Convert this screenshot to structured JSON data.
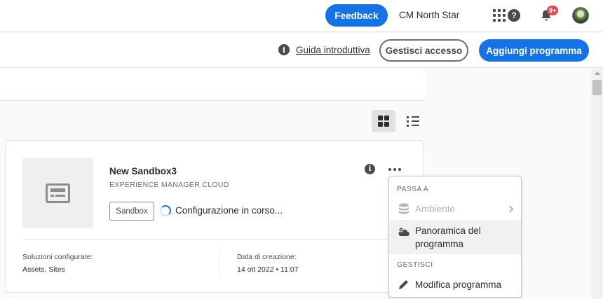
{
  "header": {
    "feedback_label": "Feedback",
    "org_name": "CM North Star",
    "apps_icon": "apps-grid-icon",
    "help_icon": "help-icon",
    "notifications_badge": "9+",
    "avatar_icon": "avatar"
  },
  "actions": {
    "guide_label": "Guida introduttiva",
    "manage_access_label": "Gestisci accesso",
    "add_program_label": "Aggiungi programma"
  },
  "view_toggle": {
    "grid_icon": "grid-view-icon",
    "list_icon": "list-view-icon",
    "selected": "grid"
  },
  "program_card": {
    "name": "New Sandbox3",
    "type": "EXPERIENCE MANAGER CLOUD",
    "badge": "Sandbox",
    "status": "Configurazione in corso...",
    "solutions_label": "Soluzioni configurate:",
    "solutions_value": "Assets, Sites",
    "created_label": "Data di creazione:",
    "created_value": "14 ott 2022 • 11:07"
  },
  "context_menu": {
    "section1_heading": "PASSA A",
    "item_environments": "Ambiente",
    "item_overview_line1": "Panoramica del",
    "item_overview_line2": "programma",
    "section2_heading": "GESTISCI",
    "item_edit": "Modifica programma"
  },
  "colors": {
    "accent": "#1473e6",
    "badge_red": "#e34850"
  }
}
